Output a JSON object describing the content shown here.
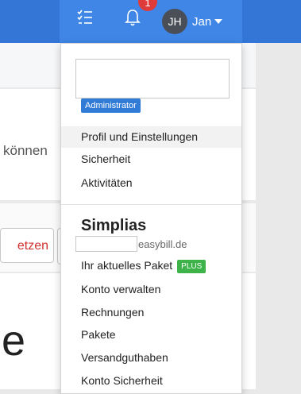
{
  "header": {
    "notification_count": "1",
    "user_initials": "JH",
    "user_name": "Jan"
  },
  "background": {
    "text_fragment": "können",
    "button_fragment": "etzen",
    "heading_fragment": "e"
  },
  "dropdown": {
    "role_badge": "Administrator",
    "user_links": [
      "Profil und Einstellungen",
      "Sicherheit",
      "Aktivitäten"
    ],
    "account_name": "Simplias",
    "account_domain": "easybill.de",
    "package_label": "Ihr aktuelles Paket",
    "package_badge": "PLUS",
    "account_links": [
      "Konto verwalten",
      "Rechnungen",
      "Pakete",
      "Versandguthaben",
      "Konto Sicherheit"
    ]
  }
}
